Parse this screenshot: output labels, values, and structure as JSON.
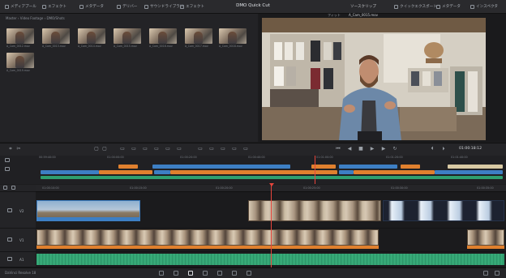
{
  "topbar": {
    "app_title": "DMO Quick Cut",
    "left_items": [
      "メディアプール",
      "エフェクト",
      "メタデータ",
      "デリバー",
      "サウンドライブラリ",
      "エフェクト"
    ],
    "right_items": [
      "クイックエクスポート",
      "メタデータ",
      "インスペクタ"
    ],
    "viewer_label": "ソースクリップ"
  },
  "media_pool": {
    "path_label": "Master › Video Footage › DMO/Shots",
    "clips": [
      {
        "name": "A_Cam_0012.mov"
      },
      {
        "name": "A_Cam_0013.mov"
      },
      {
        "name": "A_Cam_0014.mov"
      },
      {
        "name": "A_Cam_0015.mov"
      },
      {
        "name": "A_Cam_0016.mov"
      },
      {
        "name": "A_Cam_0017.mov"
      },
      {
        "name": "A_Cam_0018.mov"
      },
      {
        "name": "A_Cam_0019.mov"
      }
    ]
  },
  "viewer": {
    "zoom": "フィット",
    "clip_name": "A_Cam_0015.mov"
  },
  "transport": {
    "timecode": "01:00:18:12",
    "buttons": [
      "rewind-icon",
      "step-back-icon",
      "stop-icon",
      "play-icon",
      "step-forward-icon",
      "loop-icon"
    ]
  },
  "mini_timeline": {
    "tick_labels": [
      "00:59:40:00",
      "01:00:00:00",
      "01:00:20:00",
      "01:00:40:00",
      "01:01:00:00",
      "01:01:20:00",
      "01:01:40:00"
    ]
  },
  "ruler": {
    "tick_labels": [
      "01:00:10:00",
      "01:00:15:00",
      "01:00:20:00",
      "01:00:25:00",
      "01:00:30:00",
      "01:00:35:00"
    ]
  },
  "tracks": [
    {
      "name": "V2"
    },
    {
      "name": "V1"
    },
    {
      "name": "A1"
    }
  ],
  "bottom": {
    "project_label": "DaVinci Resolve 18"
  },
  "colors": {
    "accent_orange": "#e0802e",
    "accent_blue": "#3d7fc4",
    "accent_green": "#2f9f6f",
    "playhead": "#e8453c"
  }
}
